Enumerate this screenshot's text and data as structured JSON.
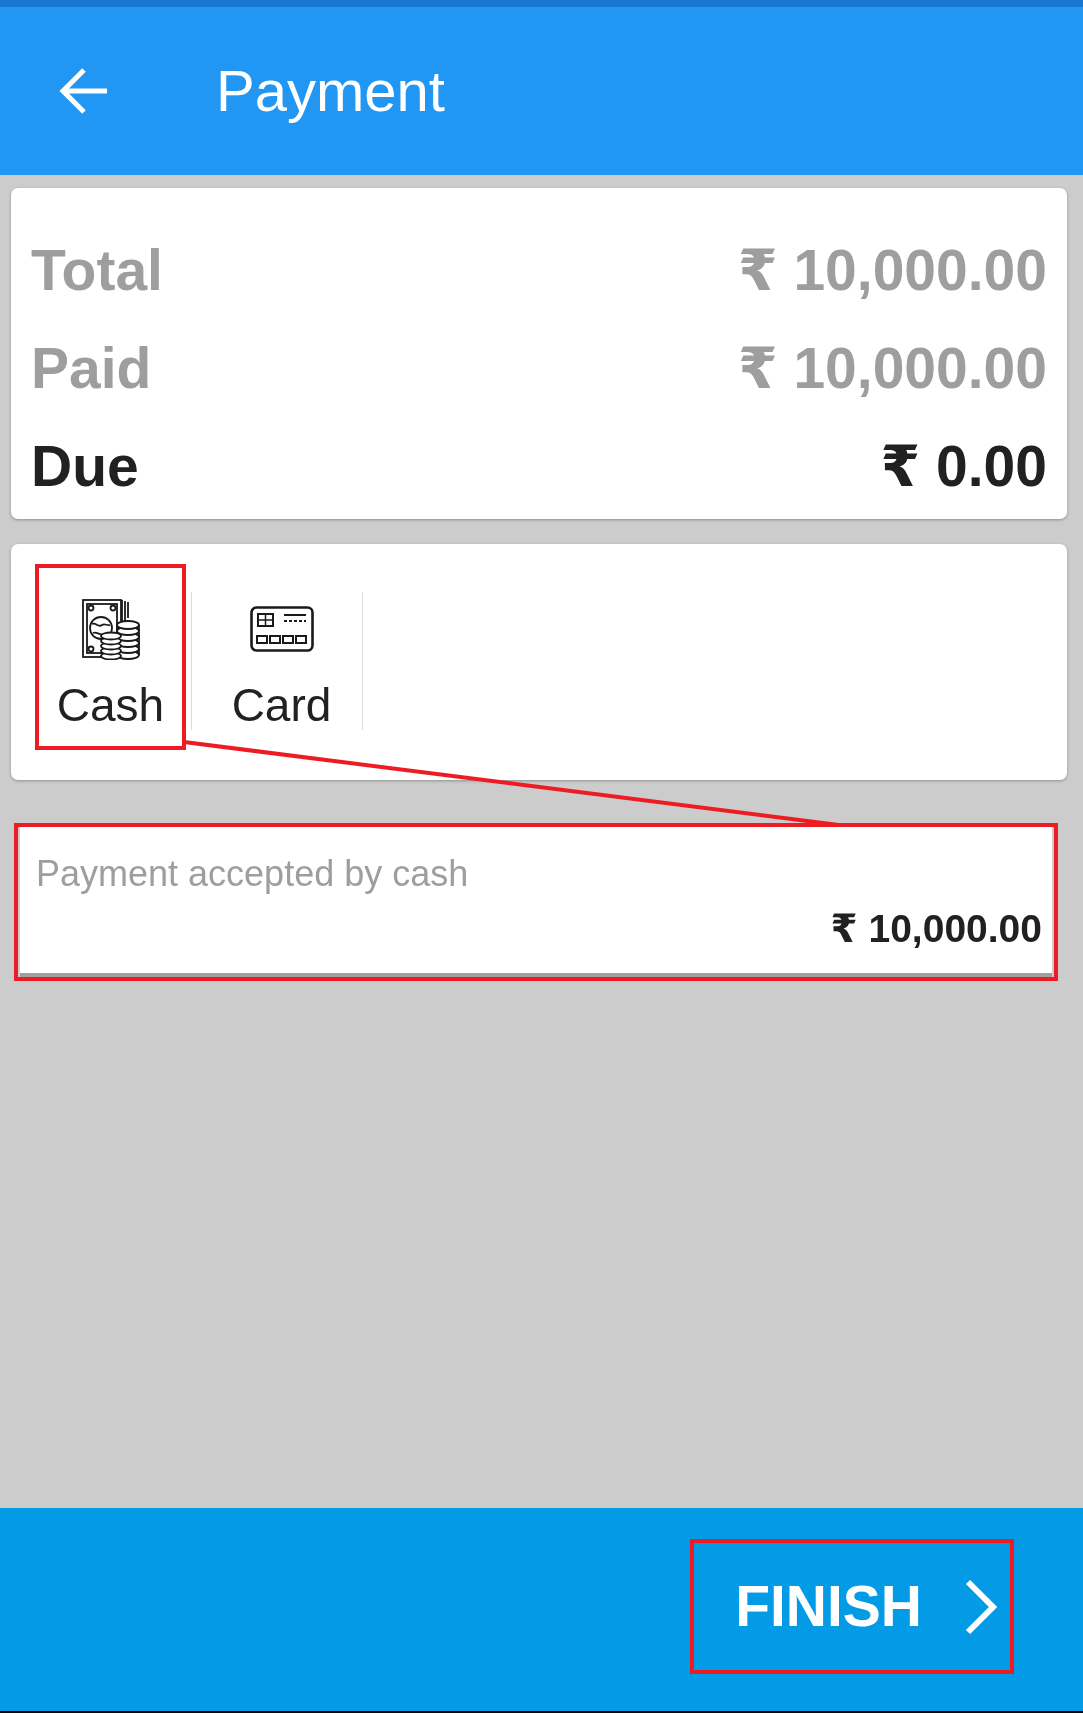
{
  "app_bar": {
    "title": "Payment"
  },
  "summary": [
    {
      "label": "Total",
      "amount": "₹ 10,000.00",
      "kind": "muted"
    },
    {
      "label": "Paid",
      "amount": "₹ 10,000.00",
      "kind": "muted"
    },
    {
      "label": "Due",
      "amount": "₹ 0.00",
      "kind": "strong"
    }
  ],
  "payment_methods": [
    {
      "label": "Cash",
      "kind": "cash",
      "highlighted": true
    },
    {
      "label": "Card",
      "kind": "card",
      "highlighted": false
    }
  ],
  "payment_entry": {
    "label": "Payment accepted by cash",
    "value": "₹ 10,000.00",
    "highlighted": true
  },
  "highlight_connector": true,
  "footer": {
    "button": "FINISH",
    "highlighted": true
  }
}
